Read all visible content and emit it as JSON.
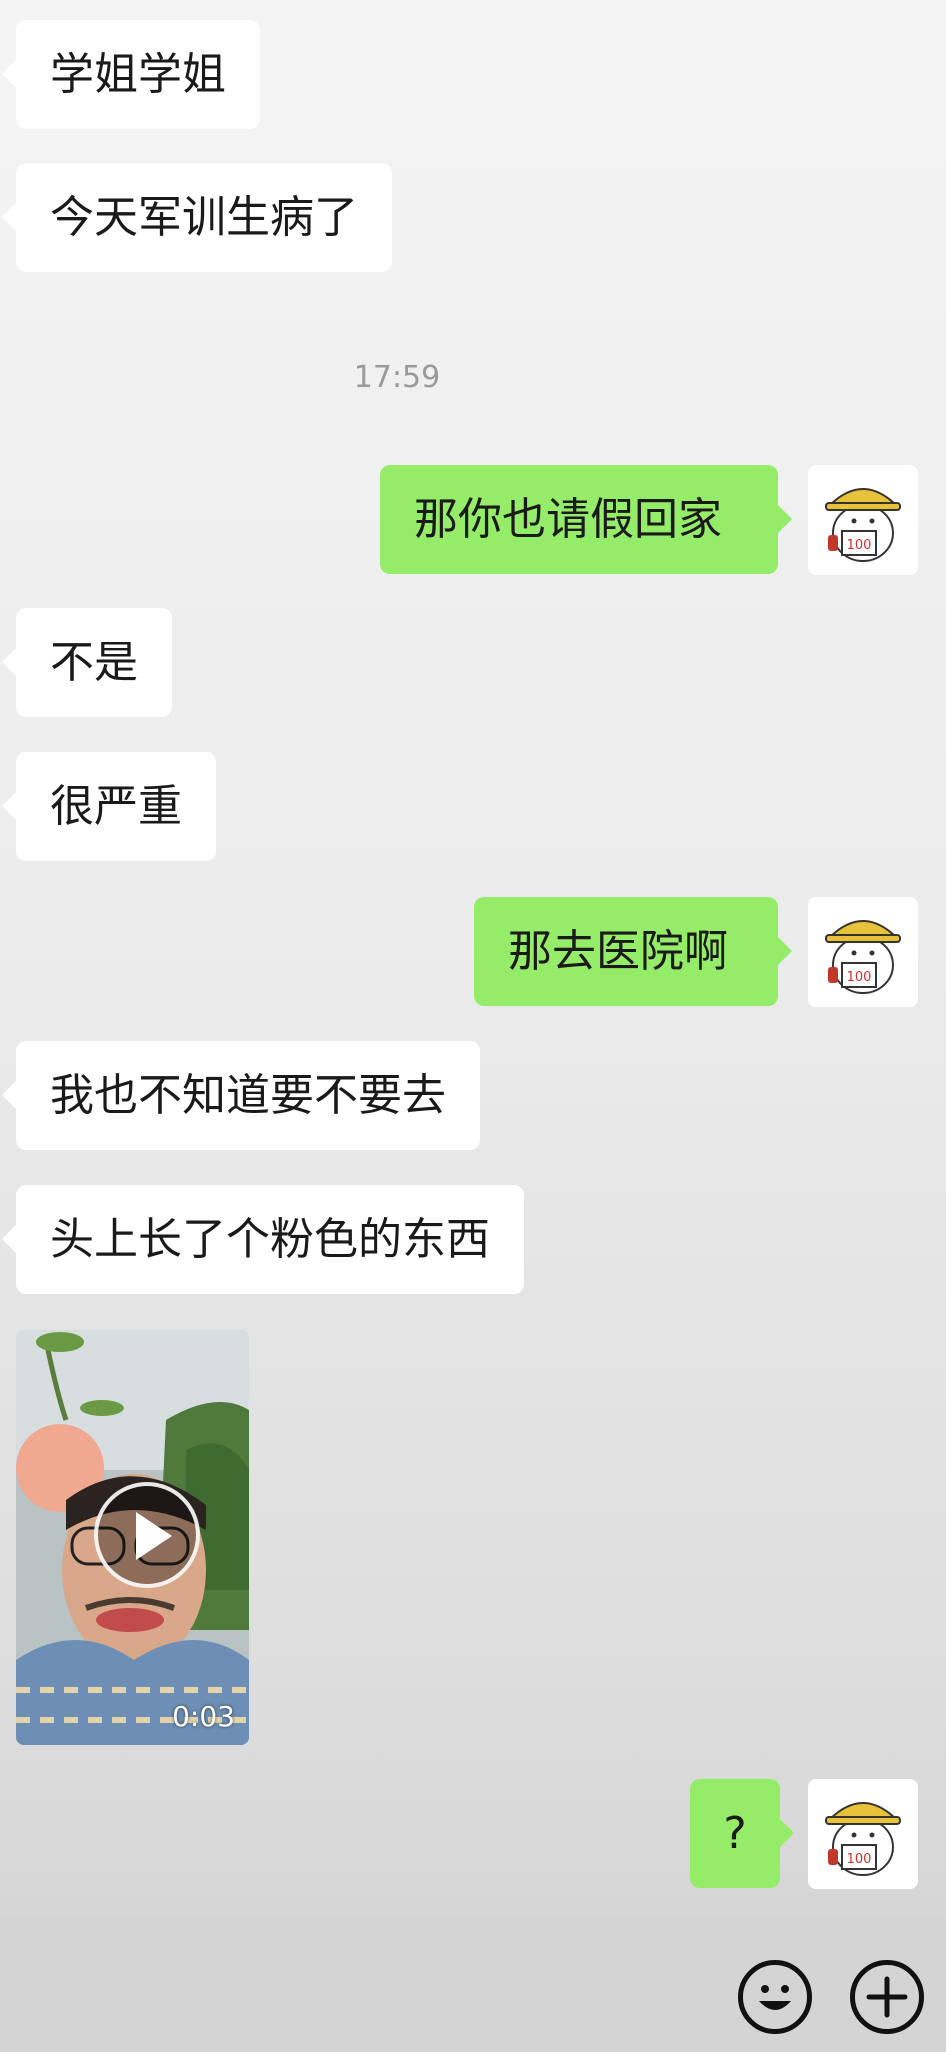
{
  "messages": [
    {
      "side": "incoming",
      "text": "学姐学姐"
    },
    {
      "side": "incoming",
      "text": "今天军训生病了"
    },
    {
      "side": "outgoing",
      "text": "那你也请假回家"
    },
    {
      "side": "incoming",
      "text": "不是"
    },
    {
      "side": "incoming",
      "text": "很严重"
    },
    {
      "side": "outgoing",
      "text": "那去医院啊"
    },
    {
      "side": "incoming",
      "text": "我也不知道要不要去"
    },
    {
      "side": "incoming",
      "text": "头上长了个粉色的东西"
    },
    {
      "side": "outgoing",
      "text": "?"
    }
  ],
  "timestamp": "17:59",
  "video": {
    "duration": "0:03"
  },
  "avatar": {
    "badge": "100"
  },
  "input_bar": {
    "icons": [
      "emoji-icon",
      "plus-icon"
    ]
  },
  "colors": {
    "outgoing_bubble": "#95ec69",
    "incoming_bubble": "#ffffff"
  }
}
